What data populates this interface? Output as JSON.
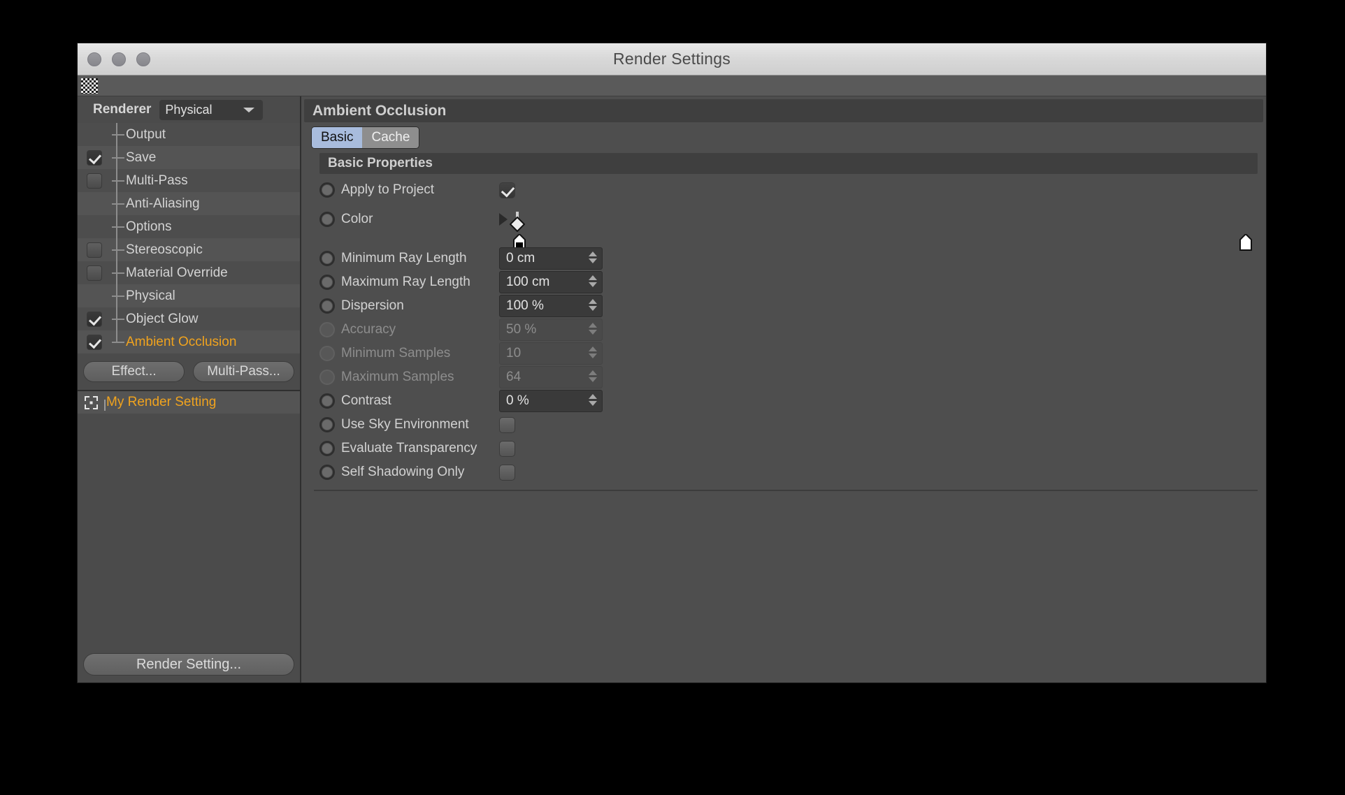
{
  "window": {
    "title": "Render Settings",
    "traffic_lights": [
      "close",
      "minimize",
      "zoom"
    ],
    "drag_handle": "drag-handle-dots"
  },
  "sidebar": {
    "renderer": {
      "label": "Renderer",
      "value": "Physical",
      "caret": "chevron-down-icon"
    },
    "tree": [
      {
        "label": "Output",
        "checkbox": "none",
        "active": false
      },
      {
        "label": "Save",
        "checkbox": "checked",
        "active": false
      },
      {
        "label": "Multi-Pass",
        "checkbox": "unchecked",
        "active": false
      },
      {
        "label": "Anti-Aliasing",
        "checkbox": "none",
        "active": false
      },
      {
        "label": "Options",
        "checkbox": "none",
        "active": false
      },
      {
        "label": "Stereoscopic",
        "checkbox": "unchecked",
        "active": false
      },
      {
        "label": "Material Override",
        "checkbox": "unchecked",
        "active": false
      },
      {
        "label": "Physical",
        "checkbox": "none",
        "active": false
      },
      {
        "label": "Object Glow",
        "checkbox": "checked",
        "active": false
      },
      {
        "label": "Ambient Occlusion",
        "checkbox": "checked",
        "active": true
      }
    ],
    "buttons": {
      "effect": "Effect...",
      "multipass": "Multi-Pass...",
      "render_setting": "Render Setting..."
    },
    "render_setting_item": {
      "label": "My Render Setting",
      "icon": "crosshair-icon"
    }
  },
  "panel": {
    "title": "Ambient Occlusion",
    "tabs": [
      {
        "label": "Basic",
        "selected": true
      },
      {
        "label": "Cache",
        "selected": false
      }
    ],
    "section_title": "Basic Properties",
    "rows": [
      {
        "label": "Apply to Project",
        "type": "checkbox",
        "value": "checked",
        "enabled": true,
        "leader": true
      },
      {
        "label": "Color",
        "type": "gradient",
        "enabled": true,
        "leader": true,
        "arrow": "triangle-right-icon"
      },
      {
        "label": "Minimum Ray Length",
        "type": "number",
        "value": "0 cm",
        "enabled": true,
        "leader": false
      },
      {
        "label": "Maximum Ray Length",
        "type": "number",
        "value": "100 cm",
        "enabled": true,
        "leader": false
      },
      {
        "label": "Dispersion",
        "type": "number",
        "value": "100 %",
        "enabled": true,
        "leader": true
      },
      {
        "label": "Accuracy",
        "type": "number",
        "value": "50 %",
        "enabled": false,
        "leader": true
      },
      {
        "label": "Minimum Samples",
        "type": "number",
        "value": "10",
        "enabled": false,
        "leader": true
      },
      {
        "label": "Maximum Samples",
        "type": "number",
        "value": "64",
        "enabled": false,
        "leader": true
      },
      {
        "label": "Contrast",
        "type": "number",
        "value": "0 %",
        "enabled": true,
        "leader": true
      },
      {
        "label": "Use Sky Environment",
        "type": "checkbox",
        "value": "unchecked",
        "enabled": true,
        "leader": false
      },
      {
        "label": "Evaluate Transparency",
        "type": "checkbox",
        "value": "unchecked",
        "enabled": true,
        "leader": false
      },
      {
        "label": "Self Shadowing Only",
        "type": "checkbox",
        "value": "unchecked",
        "enabled": true,
        "leader": false
      }
    ],
    "gradient": {
      "start_color": "#000000",
      "end_color": "#ffffff",
      "left_knob": "gradient-stop-black",
      "right_knob": "gradient-stop-white",
      "midpoint_marker": "gradient-interpolation-diamond"
    }
  },
  "colors": {
    "accent_orange": "#f0a31e",
    "tab_selected": "#a8bcdd",
    "panel_bg": "#4e4e4e"
  }
}
